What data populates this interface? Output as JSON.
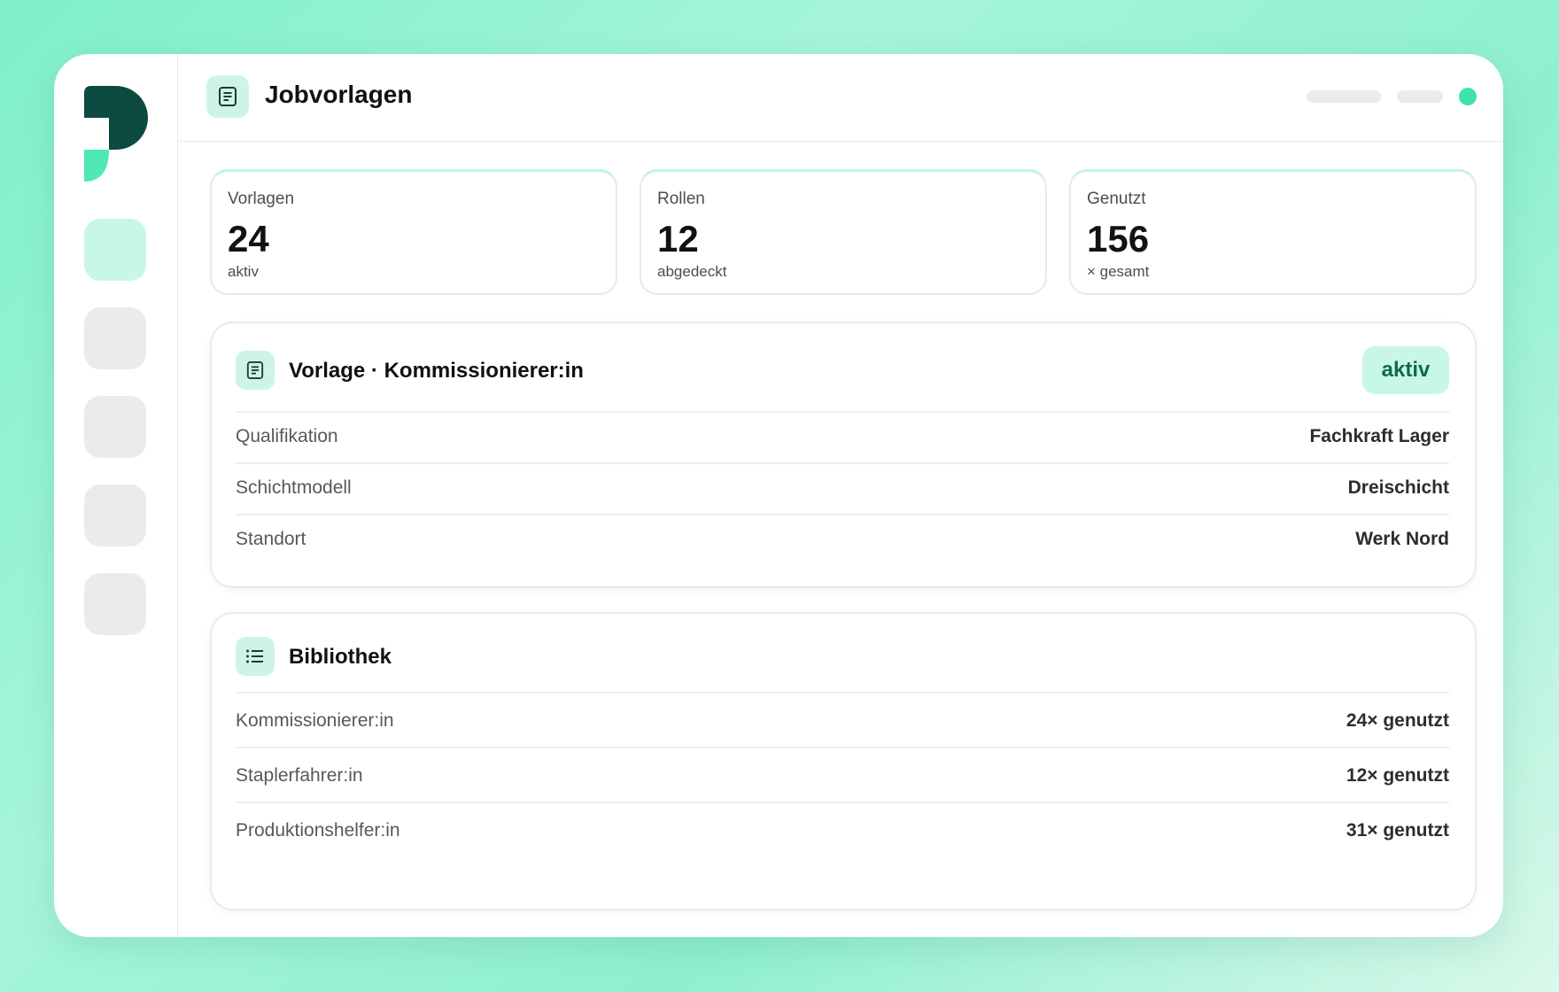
{
  "header": {
    "title": "Jobvorlagen",
    "icon": "document-icon"
  },
  "stats": [
    {
      "label": "Vorlagen",
      "value": "24",
      "sub": "aktiv"
    },
    {
      "label": "Rollen",
      "value": "12",
      "sub": "abgedeckt"
    },
    {
      "label": "Genutzt",
      "value": "156",
      "sub": "× gesamt"
    }
  ],
  "template_panel": {
    "title": "Vorlage · Kommissionierer:in",
    "badge": "aktiv",
    "rows": [
      {
        "label": "Qualifikation",
        "value": "Fachkraft Lager"
      },
      {
        "label": "Schichtmodell",
        "value": "Dreischicht"
      },
      {
        "label": "Standort",
        "value": "Werk Nord"
      }
    ]
  },
  "library_panel": {
    "title": "Bibliothek",
    "rows": [
      {
        "label": "Kommissionierer:in",
        "value": "24× genutzt"
      },
      {
        "label": "Staplerfahrer:in",
        "value": "12× genutzt"
      },
      {
        "label": "Produktionshelfer:in",
        "value": "31× genutzt"
      }
    ]
  },
  "colors": {
    "accent": "#3fe3a8",
    "accent_light": "#c9f7e6",
    "logo_dark": "#0d4a40",
    "logo_light": "#4fe8b6"
  }
}
